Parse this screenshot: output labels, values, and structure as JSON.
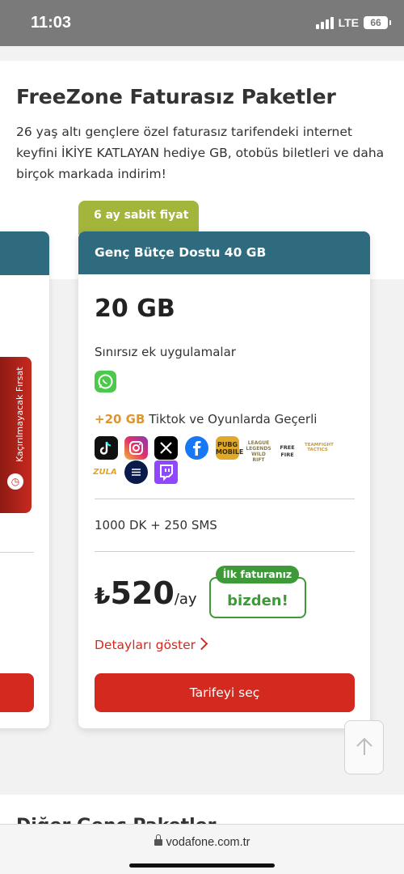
{
  "status_bar": {
    "time": "11:03",
    "network": "LTE",
    "battery": "66"
  },
  "section": {
    "title": "FreeZone Faturasız Paketler",
    "description": "26 yaş altı gençlere özel faturasız tarifendeki internet keyfini İKİYE KATLAYAN hediye GB, otobüs biletleri ve daha birçok markada indirim!"
  },
  "side_tab": {
    "label": "Kaçırılmayacak Fırsat",
    "icon": "clock-icon"
  },
  "card": {
    "badge": "6 ay sabit fiyat",
    "title": "Genç Bütçe Dostu 40 GB",
    "data": "20 GB",
    "unlimited_label": "Sınırsız ek uygulamalar",
    "extra_gb": "+20 GB",
    "extra_desc": "Tiktok ve Oyunlarda Geçerli",
    "apps": [
      "TikTok",
      "Instagram",
      "X",
      "Facebook",
      "PUBG Mobile",
      "League of Legends Wild Rift",
      "Free Fire",
      "Teamfight Tactics",
      "Zula",
      "eFootball",
      "Twitch"
    ],
    "minutes_sms": "1000 DK + 250 SMS",
    "price_currency": "₺",
    "price_value": "520",
    "price_unit": "/ay",
    "first_bill_tag": "İlk faturanız",
    "first_bill_text": "bizden!",
    "details_link": "Detayları göster",
    "select_button": "Tarifeyi seç"
  },
  "next_section_title": "Diğer Genç Paketler",
  "url_bar": {
    "url": "vodafone.com.tr"
  },
  "colors": {
    "header_teal": "#2e6b7e",
    "badge_green": "#a3b53a",
    "cta_red": "#d3291f",
    "promo_green": "#3e9a39",
    "highlight_orange": "#e0952d"
  }
}
